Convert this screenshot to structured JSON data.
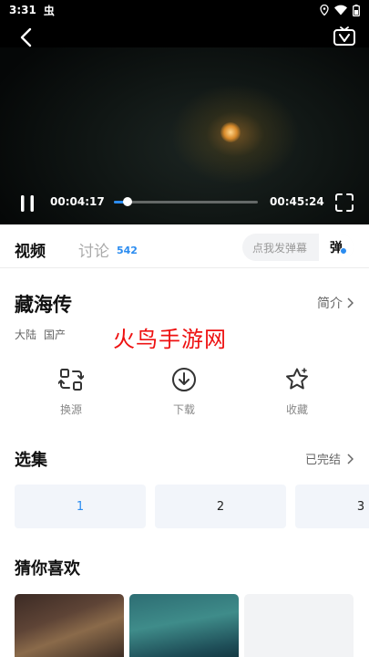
{
  "status_bar": {
    "time": "3:31",
    "app_badge": "虫"
  },
  "player": {
    "current_time": "00:04:17",
    "total_time": "00:45:24",
    "progress_fraction": 0.094
  },
  "tabs": {
    "video_label": "视频",
    "discuss_label": "讨论",
    "discuss_count": "542",
    "danmaku_placeholder": "点我发弹幕",
    "danmaku_button": "弹"
  },
  "show": {
    "title": "藏海传",
    "intro_label": "简介",
    "tags": [
      "大陆",
      "国产"
    ]
  },
  "watermark": "火鸟手游网",
  "actions": [
    {
      "label": "换源",
      "icon": "switch-source-icon"
    },
    {
      "label": "下载",
      "icon": "download-icon"
    },
    {
      "label": "收藏",
      "icon": "star-icon"
    }
  ],
  "episodes": {
    "title": "选集",
    "status_label": "已完结",
    "items": [
      "1",
      "2",
      "3"
    ]
  },
  "recommend": {
    "title": "猜你喜欢"
  },
  "colors": {
    "accent": "#2b8cf0",
    "watermark": "#e11111"
  }
}
